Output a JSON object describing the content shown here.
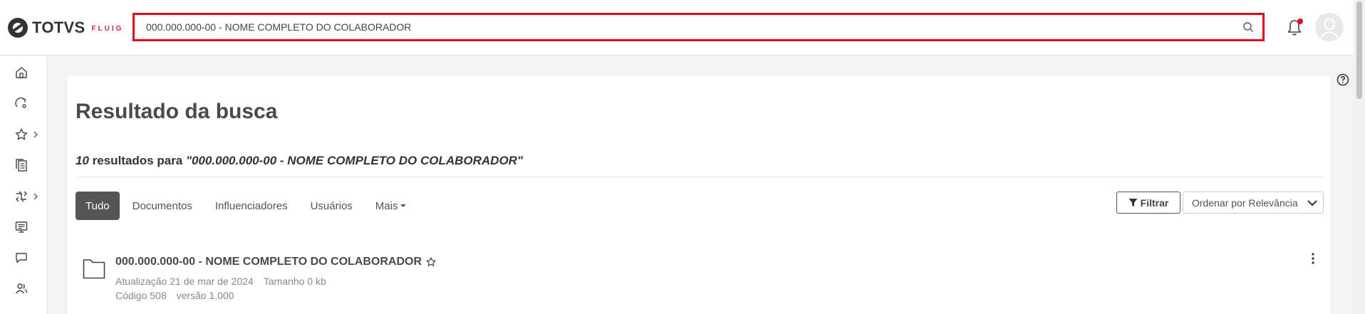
{
  "header": {
    "logo_text": "TOTVS",
    "logo_sub": "FLUIG",
    "search_value": "000.000.000-00 - NOME COMPLETO DO COLABORADOR"
  },
  "sidebar": {
    "items": [
      {
        "icon": "home-icon"
      },
      {
        "icon": "process-icon"
      },
      {
        "icon": "star-icon",
        "has_submenu": true
      },
      {
        "icon": "documents-icon"
      },
      {
        "icon": "workflow-icon",
        "has_submenu": true
      },
      {
        "icon": "presentation-icon"
      },
      {
        "icon": "chat-icon"
      },
      {
        "icon": "users-icon"
      }
    ]
  },
  "main": {
    "title": "Resultado da busca",
    "results_count": "10",
    "results_text": "resultados para",
    "results_query": "\"000.000.000-00 - NOME COMPLETO DO COLABORADOR\"",
    "tabs": [
      {
        "label": "Tudo",
        "active": true
      },
      {
        "label": "Documentos"
      },
      {
        "label": "Influenciadores"
      },
      {
        "label": "Usuários"
      },
      {
        "label": "Mais"
      }
    ],
    "filter_label": "Filtrar",
    "order_label": "Ordenar por Relevância",
    "results": [
      {
        "title": "000.000.000-00 - NOME COMPLETO DO COLABORADOR",
        "updated": "Atualização 21 de mar de 2024",
        "size": "Tamanho 0 kb",
        "code": "Código 508",
        "version": "versão 1.000"
      }
    ]
  },
  "colors": {
    "accent_red": "#e3081c",
    "active_tab": "#555555"
  }
}
